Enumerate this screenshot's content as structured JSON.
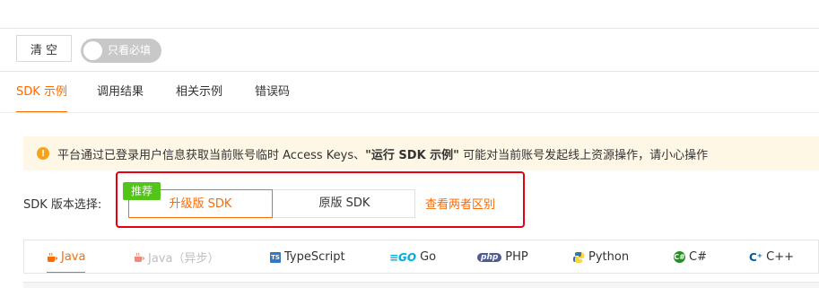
{
  "toolbar": {
    "clear_label": "清 空",
    "toggle_label": "只看必填"
  },
  "tabs": [
    {
      "label": "SDK 示例",
      "active": true
    },
    {
      "label": "调用结果",
      "active": false
    },
    {
      "label": "相关示例",
      "active": false
    },
    {
      "label": "错误码",
      "active": false
    }
  ],
  "notice": {
    "text_before": "平台通过已登录用户信息获取当前账号临时 Access Keys、",
    "text_bold": "\"运行 SDK 示例\"",
    "text_after": " 可能对当前账号发起线上资源操作，请小心操作"
  },
  "sdk": {
    "label": "SDK 版本选择:",
    "badge": "推荐",
    "option_upgrade": "升级版 SDK",
    "option_original": "原版 SDK",
    "diff_link": "查看两者区别"
  },
  "languages": [
    {
      "label": "Java",
      "icon": "java-icon",
      "state": "active"
    },
    {
      "label": "Java（异步）",
      "icon": "java-icon",
      "state": "disabled"
    },
    {
      "label": "TypeScript",
      "icon": "typescript-icon",
      "state": "normal"
    },
    {
      "label": "Go",
      "icon": "go-icon",
      "state": "normal"
    },
    {
      "label": "PHP",
      "icon": "php-icon",
      "state": "normal"
    },
    {
      "label": "Python",
      "icon": "python-icon",
      "state": "normal"
    },
    {
      "label": "C#",
      "icon": "csharp-icon",
      "state": "normal"
    },
    {
      "label": "C++",
      "icon": "cpp-icon",
      "state": "normal"
    }
  ],
  "colors": {
    "accent": "#ff6a00",
    "badge": "#52c41a",
    "highlight_box": "#e60012",
    "notice_bg": "#fff7e6"
  }
}
